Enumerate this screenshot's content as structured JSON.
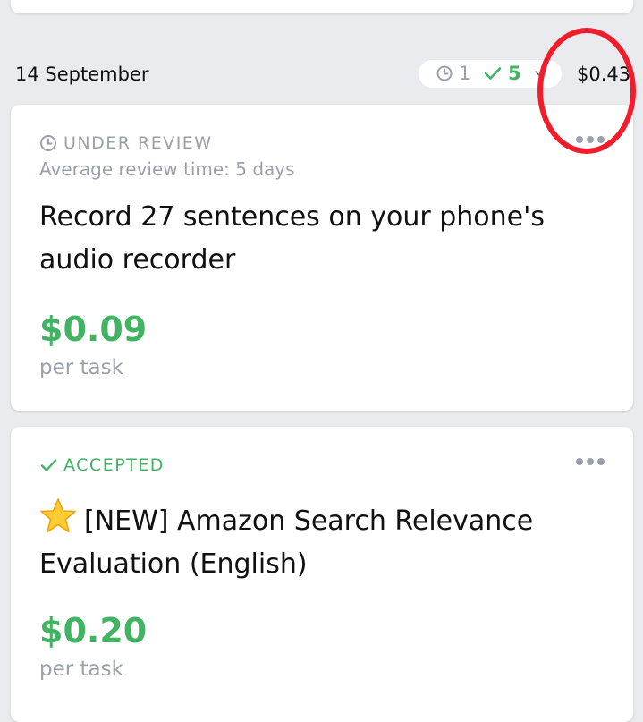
{
  "day": {
    "date": "14 September",
    "pending_count": "1",
    "accepted_count": "5",
    "total_earned": "$0.43"
  },
  "tasks": [
    {
      "status": "UNDER REVIEW",
      "review_time": "Average review time: 5 days",
      "title": "Record 27 sentences on your phone's audio recorder",
      "reward": "$0.09",
      "reward_unit": "per task"
    },
    {
      "status": "ACCEPTED",
      "title": "[NEW] Amazon Search Relevance Evaluation (English)",
      "reward": "$0.20",
      "reward_unit": "per task"
    }
  ],
  "icons": {
    "pending": "clock-icon",
    "accepted": "check-icon",
    "expand": "chevron-down-icon",
    "more": "more-icon",
    "new_badge": "star-icon"
  },
  "colors": {
    "accent_green": "#41b363",
    "muted_gray": "#9aa1aa",
    "highlight_red": "#f21d2a",
    "page_background": "#e9ebee"
  }
}
